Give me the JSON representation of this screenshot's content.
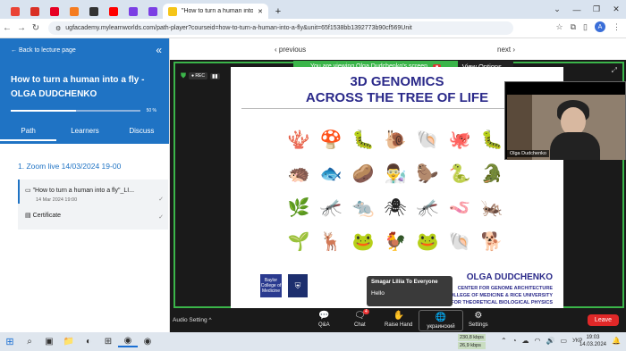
{
  "browser": {
    "tabs": [
      {
        "icon": "gmail-icon",
        "color": "#ea4335"
      },
      {
        "icon": "gmail-icon",
        "color": "#d93025"
      },
      {
        "icon": "pinterest-icon",
        "color": "#e60023"
      },
      {
        "icon": "orange-app-icon",
        "color": "#f57c20"
      },
      {
        "icon": "terminal-icon",
        "color": "#333333"
      },
      {
        "icon": "youtube-icon",
        "color": "#ff0000"
      },
      {
        "icon": "purple-app-icon",
        "color": "#7b3fe4"
      },
      {
        "icon": "purple-app-icon",
        "color": "#7b3fe4"
      }
    ],
    "active_tab_title": "\"How to turn a human into a fly",
    "url": "ugfacademy.mylearnworlds.com/path-player?courseid=how-to-turn-a-human-into-a-fly&unit=65f1538bb1392773b90cf569Unit",
    "avatar_letter": "A"
  },
  "sidebar": {
    "back_label": "← Back to lecture page",
    "title_line1": "How to turn a human into a fly -",
    "title_line2": "OLGA DUDCHENKO",
    "progress_percent": 50,
    "progress_label": "50 %",
    "tabs": [
      "Path",
      "Learners",
      "Discuss"
    ],
    "section": "1. Zoom live 14/03/2024 19-00",
    "items": [
      {
        "label": "\"How to turn a human into a fly\"_LI...",
        "date": "14 Mar 2024 19:00"
      },
      {
        "label": "Certificate"
      }
    ]
  },
  "pager": {
    "previous": "‹ previous",
    "next": "next ›"
  },
  "zoom": {
    "share_banner": "You are viewing Olga Dudchenko's screen",
    "view_options": "View Options ⌄",
    "rec_label": "REC",
    "slide": {
      "title_line1": "3D GENOMICS",
      "title_line2": "ACROSS THE TREE OF LIFE",
      "author": "OLGA DUDCHENKO",
      "affiliations": [
        "CENTER FOR GENOME ARCHITECTURE",
        "BAYLOR COLLEGE OF MEDICINE & RICE UNIVERSITY",
        "THE CENTER FOR THEORETICAL BIOLOGICAL PHYSICS"
      ],
      "logo1_text": "Baylor College of Medicine",
      "organisms": [
        "🪸",
        "🍄",
        "🐛",
        "🐌",
        "🐚",
        "🐙",
        "🐛",
        "🦔",
        "🐟",
        "🥔",
        "👨‍🔬",
        "🦫",
        "🐍",
        "🐊",
        "🌿",
        "🦟",
        "🐀",
        "🕷",
        "🦟",
        "🪱",
        "🦗",
        "🌱",
        "🦌",
        "🐸",
        "🐓",
        "🐸",
        "🐚",
        "🐕"
      ]
    },
    "camera_name": "Olga Dudchenko",
    "chat_popup": {
      "from": "Smagar Liliia To Everyone",
      "message": "Hello"
    },
    "toolbar": {
      "audio": "Audio Setting ^",
      "qa": "Q&A",
      "chat": "Chat",
      "chat_badge": "4",
      "raise_hand": "Raise Hand",
      "language": "украинский",
      "settings": "Settings",
      "leave": "Leave"
    }
  },
  "taskbar": {
    "net_up": "230,8 kbps",
    "net_down": "26,9 kbps",
    "lang": "УКР",
    "time": "19:03",
    "date": "14.03.2024"
  }
}
